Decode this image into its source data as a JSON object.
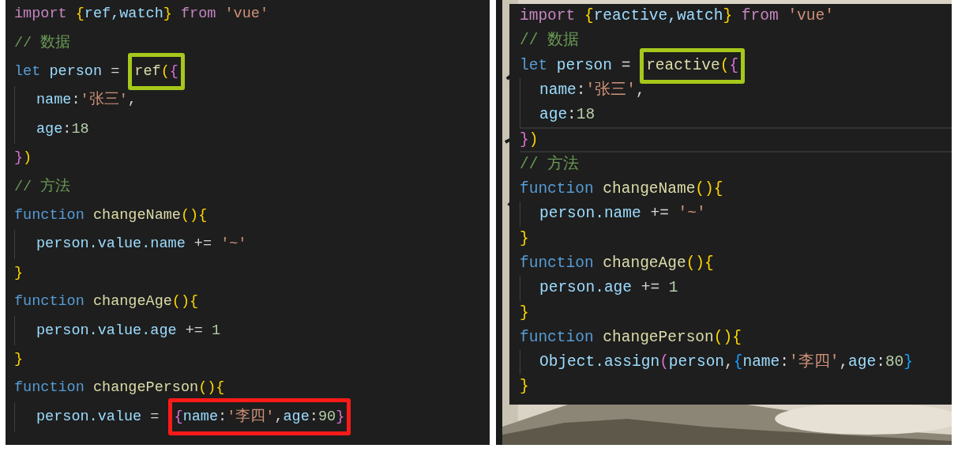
{
  "panels": [
    {
      "kind": "plain",
      "lines": [
        {
          "indented": false,
          "current": false,
          "tokens": [
            {
              "text": "import ",
              "kind": "keyword"
            },
            {
              "text": "{",
              "kind": "bracket1"
            },
            {
              "text": "ref,watch",
              "kind": "variable"
            },
            {
              "text": "} ",
              "kind": "bracket1"
            },
            {
              "text": "from ",
              "kind": "keyword"
            },
            {
              "text": "'vue'",
              "kind": "string"
            }
          ]
        },
        {
          "indented": false,
          "current": false,
          "tokens": [
            {
              "text": "// 数据",
              "kind": "comment"
            }
          ]
        },
        {
          "indented": false,
          "current": false,
          "tokens": [
            {
              "text": "let ",
              "kind": "storage"
            },
            {
              "text": "person",
              "kind": "variable"
            },
            {
              "text": " = ",
              "kind": "plain"
            },
            {
              "kind": "box",
              "color": "#a6c81a",
              "tokens": [
                {
                  "text": "ref",
                  "kind": "function"
                },
                {
                  "text": "(",
                  "kind": "bracket1"
                },
                {
                  "text": "{",
                  "kind": "bracket2"
                }
              ]
            }
          ]
        },
        {
          "indented": true,
          "current": false,
          "tokens": [
            {
              "text": "name",
              "kind": "variable"
            },
            {
              "text": ":",
              "kind": "plain"
            },
            {
              "text": "'张三'",
              "kind": "string"
            },
            {
              "text": ",",
              "kind": "plain"
            }
          ]
        },
        {
          "indented": true,
          "current": false,
          "tokens": [
            {
              "text": "age",
              "kind": "variable"
            },
            {
              "text": ":",
              "kind": "plain"
            },
            {
              "text": "18",
              "kind": "number"
            }
          ]
        },
        {
          "indented": false,
          "current": false,
          "tokens": [
            {
              "text": "}",
              "kind": "bracket2"
            },
            {
              "text": ")",
              "kind": "bracket1"
            }
          ]
        },
        {
          "indented": false,
          "current": false,
          "tokens": [
            {
              "text": "// 方法",
              "kind": "comment"
            }
          ]
        },
        {
          "indented": false,
          "current": false,
          "tokens": [
            {
              "text": "function ",
              "kind": "storage"
            },
            {
              "text": "changeName",
              "kind": "function"
            },
            {
              "text": "(){",
              "kind": "bracket1"
            }
          ]
        },
        {
          "indented": true,
          "current": false,
          "tokens": [
            {
              "text": "person.value.name",
              "kind": "variable"
            },
            {
              "text": " += ",
              "kind": "plain"
            },
            {
              "text": "'~'",
              "kind": "string"
            }
          ]
        },
        {
          "indented": false,
          "current": false,
          "tokens": [
            {
              "text": "}",
              "kind": "bracket1"
            }
          ]
        },
        {
          "indented": false,
          "current": false,
          "tokens": [
            {
              "text": "function ",
              "kind": "storage"
            },
            {
              "text": "changeAge",
              "kind": "function"
            },
            {
              "text": "(){",
              "kind": "bracket1"
            }
          ]
        },
        {
          "indented": true,
          "current": false,
          "tokens": [
            {
              "text": "person.value.age",
              "kind": "variable"
            },
            {
              "text": " += ",
              "kind": "plain"
            },
            {
              "text": "1",
              "kind": "number"
            }
          ]
        },
        {
          "indented": false,
          "current": false,
          "tokens": [
            {
              "text": "}",
              "kind": "bracket1"
            }
          ]
        },
        {
          "indented": false,
          "current": false,
          "tokens": [
            {
              "text": "function ",
              "kind": "storage"
            },
            {
              "text": "changePerson",
              "kind": "function"
            },
            {
              "text": "(){",
              "kind": "bracket1"
            }
          ]
        },
        {
          "indented": true,
          "current": false,
          "tokens": [
            {
              "text": "person.value",
              "kind": "variable"
            },
            {
              "text": " = ",
              "kind": "plain"
            },
            {
              "kind": "box",
              "color": "#ff1a1a",
              "tokens": [
                {
                  "text": "{",
                  "kind": "bracket2"
                },
                {
                  "text": "name",
                  "kind": "variable"
                },
                {
                  "text": ":",
                  "kind": "plain"
                },
                {
                  "text": "'李四'",
                  "kind": "string"
                },
                {
                  "text": ",",
                  "kind": "plain"
                },
                {
                  "text": "age",
                  "kind": "variable"
                },
                {
                  "text": ":",
                  "kind": "plain"
                },
                {
                  "text": "90",
                  "kind": "number"
                },
                {
                  "text": "}",
                  "kind": "bracket2"
                }
              ]
            }
          ]
        }
      ]
    },
    {
      "kind": "over-picture",
      "lines": [
        {
          "indented": false,
          "current": false,
          "tokens": [
            {
              "text": "import ",
              "kind": "keyword"
            },
            {
              "text": "{",
              "kind": "bracket1"
            },
            {
              "text": "reactive,watch",
              "kind": "variable"
            },
            {
              "text": "} ",
              "kind": "bracket1"
            },
            {
              "text": "from ",
              "kind": "keyword"
            },
            {
              "text": "'vue'",
              "kind": "string"
            }
          ]
        },
        {
          "indented": false,
          "current": false,
          "tokens": [
            {
              "text": "// 数据",
              "kind": "comment"
            }
          ]
        },
        {
          "indented": false,
          "current": false,
          "tokens": [
            {
              "text": "let ",
              "kind": "storage"
            },
            {
              "text": "person",
              "kind": "variable"
            },
            {
              "text": " = ",
              "kind": "plain"
            },
            {
              "kind": "box",
              "color": "#a6c81a",
              "tokens": [
                {
                  "text": "reactive",
                  "kind": "function"
                },
                {
                  "text": "(",
                  "kind": "bracket1"
                },
                {
                  "text": "{",
                  "kind": "bracket2"
                }
              ]
            }
          ]
        },
        {
          "indented": true,
          "current": false,
          "tokens": [
            {
              "text": "name",
              "kind": "variable"
            },
            {
              "text": ":",
              "kind": "plain"
            },
            {
              "text": "'张三'",
              "kind": "string"
            },
            {
              "text": ",",
              "kind": "plain"
            }
          ]
        },
        {
          "indented": true,
          "current": false,
          "tokens": [
            {
              "text": "age",
              "kind": "variable"
            },
            {
              "text": ":",
              "kind": "plain"
            },
            {
              "text": "18",
              "kind": "number"
            }
          ]
        },
        {
          "indented": false,
          "current": true,
          "tokens": [
            {
              "text": "}",
              "kind": "bracket2"
            },
            {
              "text": ")",
              "kind": "bracket1"
            }
          ]
        },
        {
          "indented": false,
          "current": false,
          "tokens": [
            {
              "text": "// 方法",
              "kind": "comment"
            }
          ]
        },
        {
          "indented": false,
          "current": false,
          "tokens": [
            {
              "text": "function ",
              "kind": "storage"
            },
            {
              "text": "changeName",
              "kind": "function"
            },
            {
              "text": "(){",
              "kind": "bracket1"
            }
          ]
        },
        {
          "indented": true,
          "current": false,
          "tokens": [
            {
              "text": "person.name",
              "kind": "variable"
            },
            {
              "text": " += ",
              "kind": "plain"
            },
            {
              "text": "'~'",
              "kind": "string"
            }
          ]
        },
        {
          "indented": false,
          "current": false,
          "tokens": [
            {
              "text": "}",
              "kind": "bracket1"
            }
          ]
        },
        {
          "indented": false,
          "current": false,
          "tokens": [
            {
              "text": "function ",
              "kind": "storage"
            },
            {
              "text": "changeAge",
              "kind": "function"
            },
            {
              "text": "(){",
              "kind": "bracket1"
            }
          ]
        },
        {
          "indented": true,
          "current": false,
          "tokens": [
            {
              "text": "person.age",
              "kind": "variable"
            },
            {
              "text": " += ",
              "kind": "plain"
            },
            {
              "text": "1",
              "kind": "number"
            }
          ]
        },
        {
          "indented": false,
          "current": false,
          "tokens": [
            {
              "text": "}",
              "kind": "bracket1"
            }
          ]
        },
        {
          "indented": false,
          "current": false,
          "tokens": [
            {
              "text": "function ",
              "kind": "storage"
            },
            {
              "text": "changePerson",
              "kind": "function"
            },
            {
              "text": "(){",
              "kind": "bracket1"
            }
          ]
        },
        {
          "indented": true,
          "current": false,
          "tokens": [
            {
              "text": "Object.assign",
              "kind": "variable"
            },
            {
              "text": "(",
              "kind": "bracket2"
            },
            {
              "text": "person",
              "kind": "variable"
            },
            {
              "text": ",",
              "kind": "plain"
            },
            {
              "text": "{",
              "kind": "bracket3"
            },
            {
              "text": "name",
              "kind": "variable"
            },
            {
              "text": ":",
              "kind": "plain"
            },
            {
              "text": "'李四'",
              "kind": "string"
            },
            {
              "text": ",",
              "kind": "plain"
            },
            {
              "text": "age",
              "kind": "variable"
            },
            {
              "text": ":",
              "kind": "plain"
            },
            {
              "text": "80",
              "kind": "number"
            },
            {
              "text": "}",
              "kind": "bracket3"
            }
          ]
        },
        {
          "indented": false,
          "current": false,
          "tokens": [
            {
              "text": "}",
              "kind": "bracket1"
            }
          ]
        }
      ]
    }
  ]
}
